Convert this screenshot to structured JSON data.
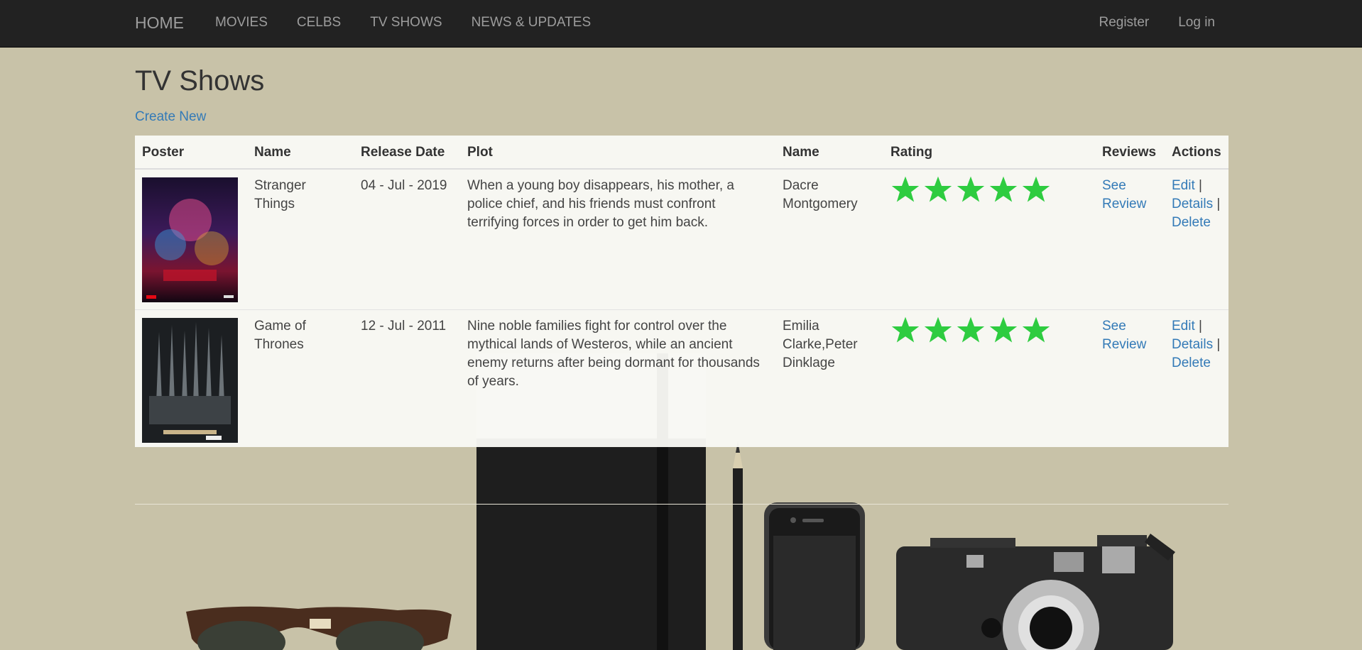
{
  "nav": {
    "brand": "HOME",
    "links": [
      "MOVIES",
      "CELBS",
      "TV SHOWS",
      "NEWS & UPDATES"
    ],
    "right": [
      "Register",
      "Log in"
    ]
  },
  "page": {
    "title": "TV Shows",
    "create_new": "Create New"
  },
  "table": {
    "headers": [
      "Poster",
      "Name",
      "Release Date",
      "Plot",
      "Name",
      "Rating",
      "Reviews",
      "Actions"
    ],
    "rows": [
      {
        "name": "Stranger Things",
        "release_date": "04 - Jul - 2019",
        "plot": "When a young boy disappears, his mother, a police chief, and his friends must confront terrifying forces in order to get him back.",
        "cast": "Dacre Montgomery",
        "rating": 5,
        "review_link": "See Review",
        "actions": {
          "edit": "Edit",
          "details": "Details",
          "delete": "Delete",
          "sep": "|"
        }
      },
      {
        "name": "Game of Thrones",
        "release_date": "12 - Jul - 2011",
        "plot": "Nine noble families fight for control over the mythical lands of Westeros, while an ancient enemy returns after being dormant for thousands of years.",
        "cast": "Emilia Clarke,Peter Dinklage",
        "rating": 5,
        "review_link": "See Review",
        "actions": {
          "edit": "Edit",
          "details": "Details",
          "delete": "Delete",
          "sep": "|"
        }
      }
    ]
  },
  "colors": {
    "navbar": "#222222",
    "background": "#c8c2a8",
    "link": "#337ab7",
    "star": "#2ecc40"
  },
  "icons": [
    "star-icon"
  ]
}
